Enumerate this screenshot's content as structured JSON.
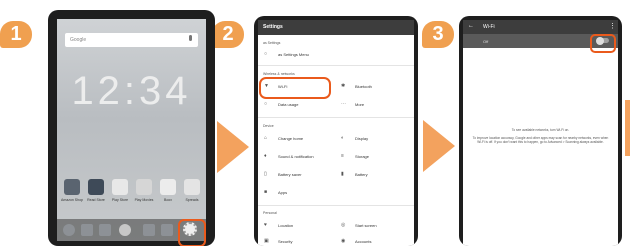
{
  "steps": [
    {
      "number": "1"
    },
    {
      "number": "2"
    },
    {
      "number": "3"
    }
  ],
  "phone1": {
    "search_placeholder": "Google",
    "clock": "12:34",
    "apps": [
      "Amazon Shop",
      "Read Store",
      "Play Store",
      "Play Movies",
      "Boox",
      "Spreads"
    ]
  },
  "phone2": {
    "title": "Settings",
    "sections": {
      "top": "as Settings",
      "wireless": "Wireless & networks",
      "device": "Device",
      "personal": "Personal"
    },
    "items": {
      "menu": "as Settings Menu",
      "wifi": "Wi-Fi",
      "bluetooth": "Bluetooth",
      "data_usage": "Data usage",
      "more": "More",
      "change_home": "Change home",
      "display": "Display",
      "sound": "Sound & notification",
      "storage": "Storage",
      "battery_saver": "Battery saver",
      "battery": "Battery",
      "apps": "Apps",
      "location": "Location",
      "start_screen": "Start screen",
      "security": "Security",
      "accounts": "Accounts"
    }
  },
  "phone3": {
    "title": "Wi-Fi",
    "toggle_label": "Off",
    "message_line1": "To see available networks, turn Wi-Fi on.",
    "message_line2": "To improve location accuracy, Google and other apps may scan for nearby networks, even when Wi-Fi is off. If you don't want this to happen, go to Advanced > Scanning always available."
  },
  "colors": {
    "accent": "#f0a050",
    "highlight": "#ea5a1c",
    "arrow": "#f3a25e"
  }
}
